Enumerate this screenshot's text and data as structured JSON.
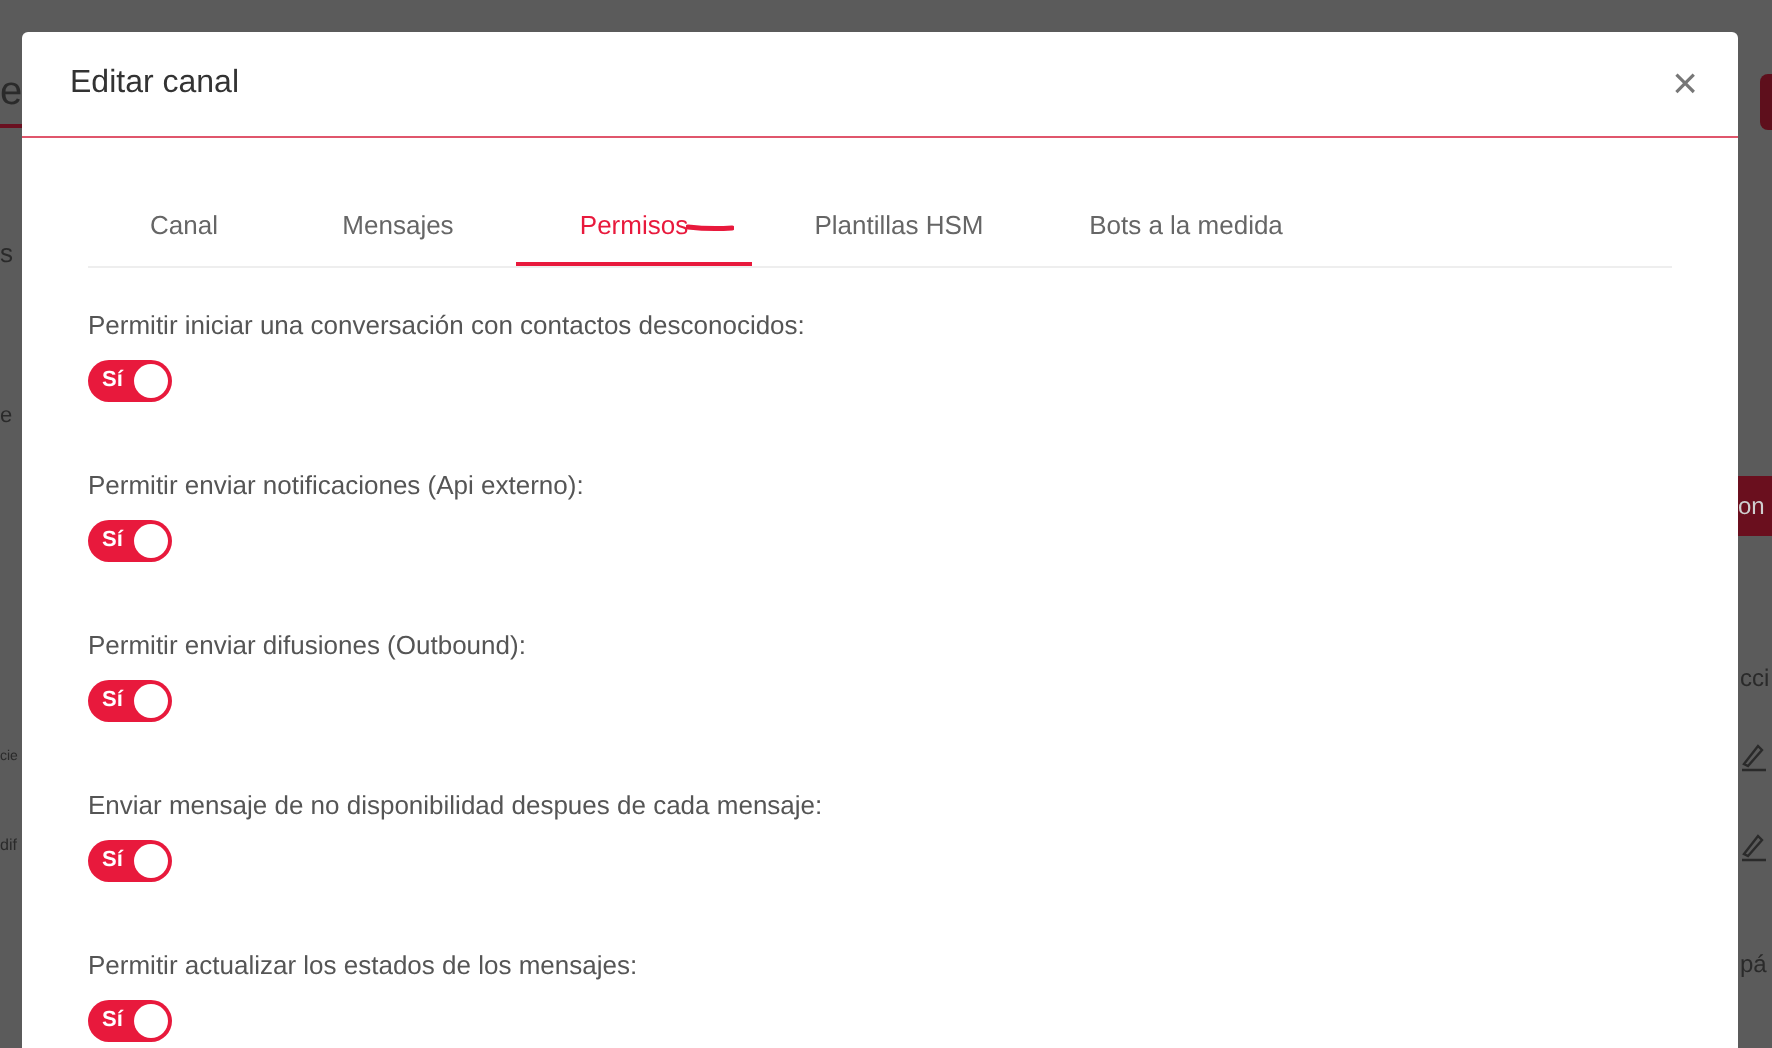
{
  "background": {
    "heading": "e",
    "left_texts": [
      "s",
      "e",
      "cie",
      "dif"
    ],
    "right_texts": [
      {
        "text": "on",
        "kind": "button"
      },
      {
        "text": "cci",
        "kind": "text"
      },
      {
        "text": "pá",
        "kind": "text"
      }
    ]
  },
  "dialog": {
    "title": "Editar canal",
    "close": "×"
  },
  "tabs": [
    {
      "label": "Canal",
      "selected": false
    },
    {
      "label": "Mensajes",
      "selected": false
    },
    {
      "label": "Permisos",
      "selected": true
    },
    {
      "label": "Plantillas HSM",
      "selected": false
    },
    {
      "label": "Bots a la medida",
      "selected": false
    }
  ],
  "permissions": [
    {
      "label": "Permitir iniciar una conversación con contactos desconocidos:",
      "on": true,
      "switch_text": "Sí"
    },
    {
      "label": "Permitir enviar notificaciones (Api externo):",
      "on": true,
      "switch_text": "Sí"
    },
    {
      "label": "Permitir enviar difusiones (Outbound):",
      "on": true,
      "switch_text": "Sí"
    },
    {
      "label": "Enviar mensaje de no disponibilidad despues de cada mensaje:",
      "on": true,
      "switch_text": "Sí"
    },
    {
      "label": "Permitir actualizar los estados de los mensajes:",
      "on": true,
      "switch_text": "Sí"
    }
  ]
}
